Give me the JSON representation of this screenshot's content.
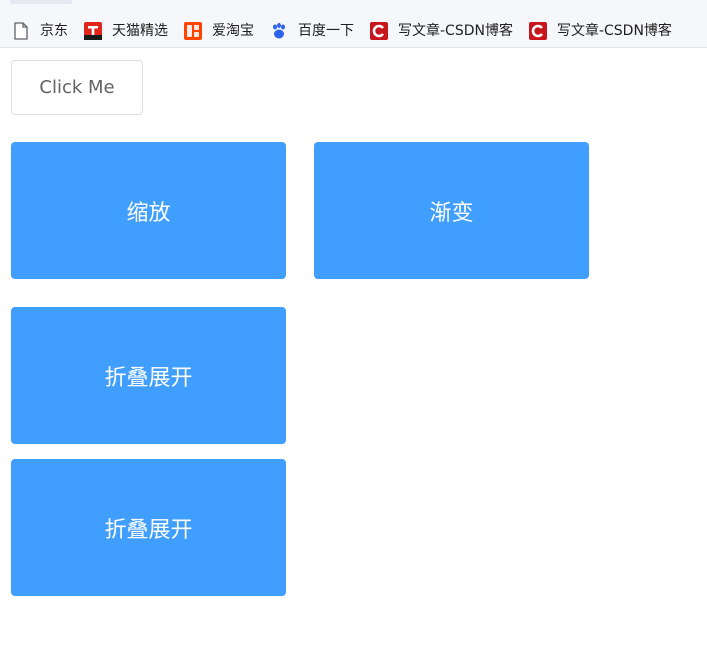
{
  "bookmarks": [
    {
      "label": "京东",
      "icon": "file-icon"
    },
    {
      "label": "天猫精选",
      "icon": "tmall-icon"
    },
    {
      "label": "爱淘宝",
      "icon": "taobao-icon"
    },
    {
      "label": "百度一下",
      "icon": "baidu-paw-icon"
    },
    {
      "label": "写文章-CSDN博客",
      "icon": "csdn-icon"
    },
    {
      "label": "写文章-CSDN博客",
      "icon": "csdn-icon"
    }
  ],
  "button": {
    "label": "Click Me"
  },
  "boxes": [
    {
      "label": "缩放"
    },
    {
      "label": "渐变"
    },
    {
      "label": "折叠展开"
    },
    {
      "label": "折叠展开"
    }
  ],
  "colors": {
    "primary": "#409eff",
    "button_text": "#606266",
    "button_border": "#dcdfe6",
    "tmall_red": "#e1251b",
    "taobao_red": "#ff4400",
    "baidu_blue": "#2e64eb",
    "csdn_red": "#c8161e"
  }
}
